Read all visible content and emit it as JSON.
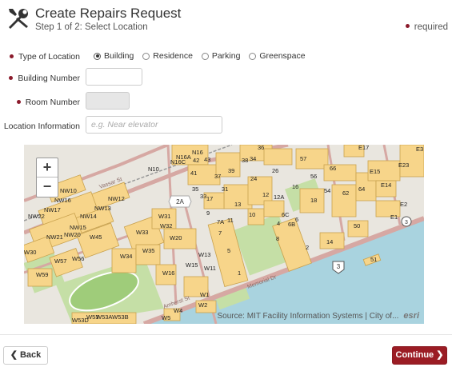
{
  "header": {
    "title": "Create Repairs Request",
    "subtitle": "Step 1 of 2: Select Location",
    "required_label": "required",
    "icon": "tools-icon"
  },
  "form": {
    "location_type": {
      "label": "Type of Location",
      "options": [
        "Building",
        "Residence",
        "Parking",
        "Greenspace"
      ],
      "selected": "Building"
    },
    "building_number": {
      "label": "Building Number",
      "value": ""
    },
    "room_number": {
      "label": "Room Number",
      "value": ""
    },
    "location_info": {
      "label": "Location Information",
      "placeholder": "e.g. Near elevator"
    }
  },
  "map": {
    "zoom_in": "+",
    "zoom_out": "−",
    "attribution": "Source: MIT Facility Information Systems | City of...",
    "logo": "esri",
    "labels": [
      "N16",
      "N16A",
      "N16C",
      "N10",
      "41",
      "42",
      "43",
      "36",
      "E17",
      "E3",
      "E15",
      "E23",
      "NW10",
      "NW16",
      "NW12",
      "NW17",
      "NW13",
      "NW22",
      "NW14",
      "NW15",
      "NW20",
      "NW21",
      "W45",
      "W31",
      "W32",
      "W33",
      "W20",
      "W30",
      "W34",
      "W35",
      "W57",
      "W56",
      "W59",
      "W16",
      "W15",
      "W13",
      "W11",
      "W1",
      "W2",
      "W4",
      "W5",
      "W53",
      "W53D",
      "W53A",
      "W53B",
      "35",
      "37",
      "39",
      "38",
      "34",
      "26",
      "57",
      "66",
      "56",
      "16",
      "12",
      "12A",
      "18",
      "54",
      "62",
      "64",
      "E14",
      "E2",
      "E1",
      "33",
      "31",
      "24",
      "9",
      "13",
      "10",
      "17",
      "7A",
      "11",
      "7",
      "6C",
      "4",
      "6B",
      "6",
      "2",
      "5",
      "1",
      "8",
      "50",
      "14",
      "3",
      "51"
    ],
    "road_labels": [
      "Vassar St",
      "Amherst St",
      "Memorial Dr"
    ],
    "route_badges": [
      "2A",
      "3",
      "3"
    ],
    "colors": {
      "building": "#f7d58a",
      "building_outline": "#c9a24e",
      "road": "#d6a8a3",
      "water": "#a9d3df",
      "park": "#c5dfa6",
      "land": "#e9e6df"
    }
  },
  "footer": {
    "back_label": "Back",
    "continue_label": "Continue",
    "accent": "#9b1c24"
  }
}
